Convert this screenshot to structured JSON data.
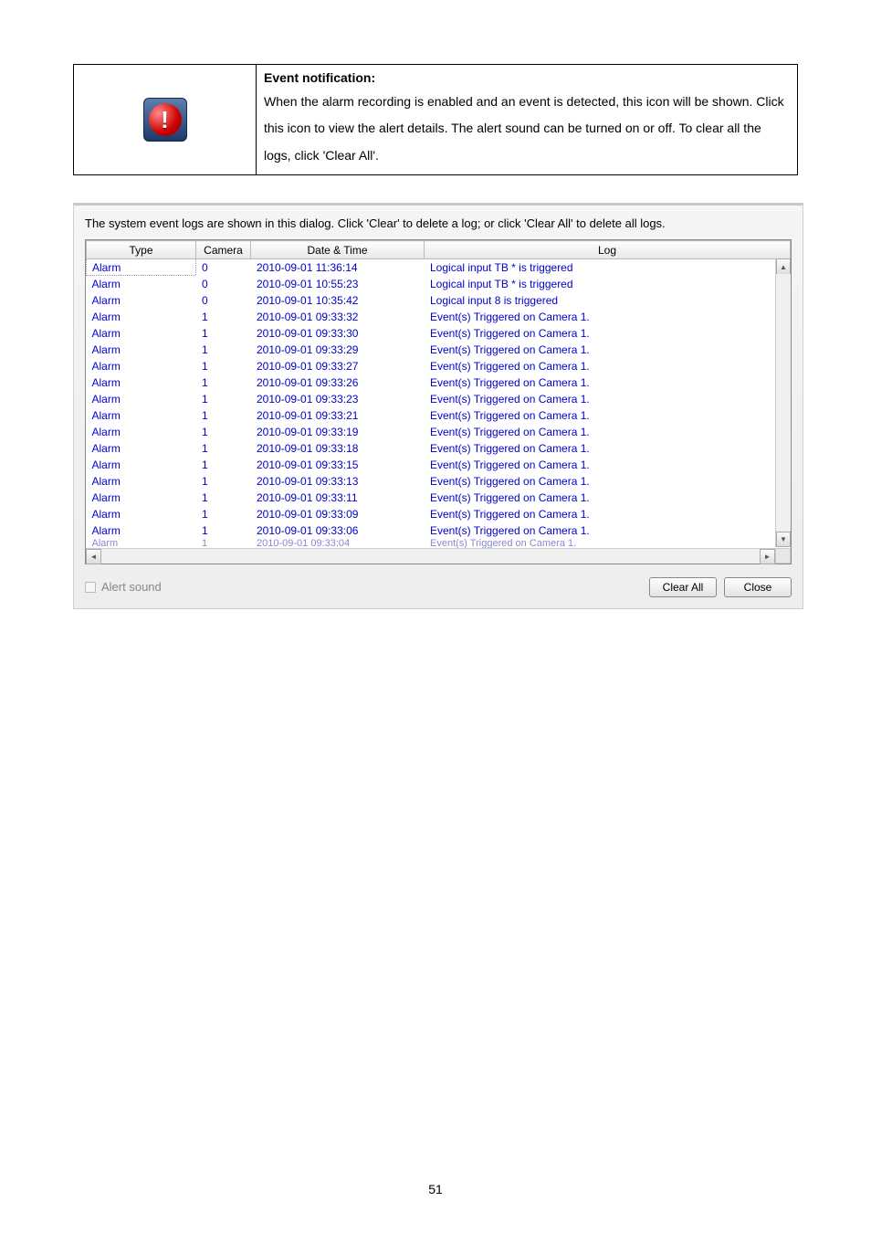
{
  "description": {
    "heading": "Event notification:",
    "body": "When the alarm recording is enabled and an event is detected, this icon will be shown.   Click this icon to view the alert details. The alert sound can be turned on or off.   To clear all the logs, click 'Clear All'."
  },
  "dialog": {
    "intro": "The system event logs are shown in this dialog. Click 'Clear' to delete a log; or click 'Clear All' to delete all logs.",
    "headers": {
      "type": "Type",
      "camera": "Camera",
      "datetime": "Date & Time",
      "log": "Log"
    },
    "rows": [
      {
        "type": "Alarm",
        "camera": "0",
        "datetime": "2010-09-01 11:36:14",
        "log": "Logical input TB     *     is triggered"
      },
      {
        "type": "Alarm",
        "camera": "0",
        "datetime": "2010-09-01 10:55:23",
        "log": "Logical input TB     *     is triggered"
      },
      {
        "type": "Alarm",
        "camera": "0",
        "datetime": "2010-09-01 10:35:42",
        "log": "Logical input 8 is triggered"
      },
      {
        "type": "Alarm",
        "camera": "1",
        "datetime": "2010-09-01 09:33:32",
        "log": "Event(s) Triggered on Camera 1."
      },
      {
        "type": "Alarm",
        "camera": "1",
        "datetime": "2010-09-01 09:33:30",
        "log": "Event(s) Triggered on Camera 1."
      },
      {
        "type": "Alarm",
        "camera": "1",
        "datetime": "2010-09-01 09:33:29",
        "log": "Event(s) Triggered on Camera 1."
      },
      {
        "type": "Alarm",
        "camera": "1",
        "datetime": "2010-09-01 09:33:27",
        "log": "Event(s) Triggered on Camera 1."
      },
      {
        "type": "Alarm",
        "camera": "1",
        "datetime": "2010-09-01 09:33:26",
        "log": "Event(s) Triggered on Camera 1."
      },
      {
        "type": "Alarm",
        "camera": "1",
        "datetime": "2010-09-01 09:33:23",
        "log": "Event(s) Triggered on Camera 1."
      },
      {
        "type": "Alarm",
        "camera": "1",
        "datetime": "2010-09-01 09:33:21",
        "log": "Event(s) Triggered on Camera 1."
      },
      {
        "type": "Alarm",
        "camera": "1",
        "datetime": "2010-09-01 09:33:19",
        "log": "Event(s) Triggered on Camera 1."
      },
      {
        "type": "Alarm",
        "camera": "1",
        "datetime": "2010-09-01 09:33:18",
        "log": "Event(s) Triggered on Camera 1."
      },
      {
        "type": "Alarm",
        "camera": "1",
        "datetime": "2010-09-01 09:33:15",
        "log": "Event(s) Triggered on Camera 1."
      },
      {
        "type": "Alarm",
        "camera": "1",
        "datetime": "2010-09-01 09:33:13",
        "log": "Event(s) Triggered on Camera 1."
      },
      {
        "type": "Alarm",
        "camera": "1",
        "datetime": "2010-09-01 09:33:11",
        "log": "Event(s) Triggered on Camera 1."
      },
      {
        "type": "Alarm",
        "camera": "1",
        "datetime": "2010-09-01 09:33:09",
        "log": "Event(s) Triggered on Camera 1."
      },
      {
        "type": "Alarm",
        "camera": "1",
        "datetime": "2010-09-01 09:33:06",
        "log": "Event(s) Triggered on Camera 1."
      }
    ],
    "cutoff_row": {
      "type": "Alarm",
      "camera": "1",
      "datetime": "2010-09-01 09:33:04",
      "log": "Event(s) Triggered on Camera 1."
    },
    "alert_sound_label": "Alert sound",
    "buttons": {
      "clear_all": "Clear All",
      "close": "Close"
    }
  },
  "page_number": "51"
}
